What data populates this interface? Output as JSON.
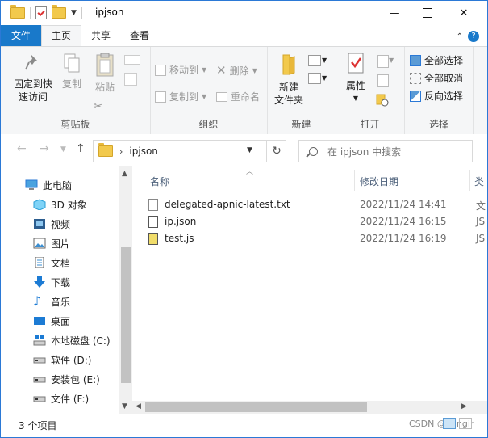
{
  "window": {
    "title": "ipjson",
    "minimize_glyph": "—",
    "close_glyph": "✕"
  },
  "ribbon_tabs": [
    "文件",
    "主页",
    "共享",
    "查看"
  ],
  "ribbon": {
    "clipboard": {
      "pin": "固定到快\n速访问",
      "copy": "复制",
      "paste": "粘贴",
      "label": "剪贴板"
    },
    "organize": {
      "move_to": "移动到",
      "copy_to": "复制到",
      "delete": "删除",
      "rename": "重命名",
      "label": "组织"
    },
    "new": {
      "new_folder": "新建\n文件夹",
      "label": "新建"
    },
    "open": {
      "properties": "属性",
      "label": "打开"
    },
    "select": {
      "select_all": "全部选择",
      "select_none": "全部取消",
      "invert": "反向选择",
      "label": "选择"
    }
  },
  "address": {
    "path": "ipjson",
    "search_placeholder": "在 ipjson 中搜索"
  },
  "nav": {
    "items": [
      {
        "label": "此电脑",
        "icon": "computer-icon"
      },
      {
        "label": "3D 对象",
        "icon": "3d-objects-icon"
      },
      {
        "label": "视频",
        "icon": "video-icon"
      },
      {
        "label": "图片",
        "icon": "pictures-icon"
      },
      {
        "label": "文档",
        "icon": "documents-icon"
      },
      {
        "label": "下载",
        "icon": "download-icon"
      },
      {
        "label": "音乐",
        "icon": "music-icon"
      },
      {
        "label": "桌面",
        "icon": "desktop-icon"
      },
      {
        "label": "本地磁盘 (C:)",
        "icon": "drive-c-icon"
      },
      {
        "label": "软件 (D:)",
        "icon": "drive-icon"
      },
      {
        "label": "安装包 (E:)",
        "icon": "drive-icon"
      },
      {
        "label": "文件 (F:)",
        "icon": "drive-icon"
      }
    ]
  },
  "columns": {
    "name": "名称",
    "date": "修改日期",
    "type": "类"
  },
  "files": [
    {
      "name": "delegated-apnic-latest.txt",
      "date": "2022/11/24 14:41",
      "type": "文",
      "icon": "text-file-icon"
    },
    {
      "name": "ip.json",
      "date": "2022/11/24 16:15",
      "type": "JS",
      "icon": "json-file-icon"
    },
    {
      "name": "test.js",
      "date": "2022/11/24 16:19",
      "type": "JS",
      "icon": "js-file-icon"
    }
  ],
  "status": {
    "count": "3 个项目",
    "watermark": "CSDN @lhingir"
  }
}
